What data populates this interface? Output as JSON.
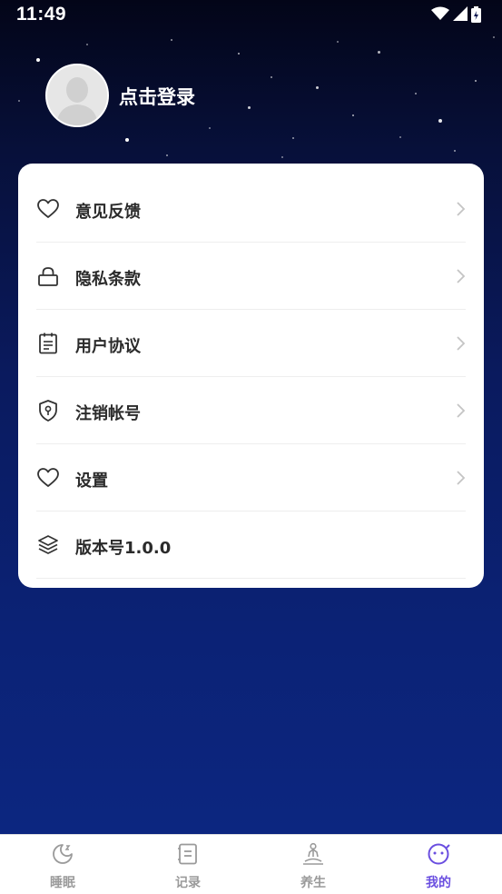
{
  "status_bar": {
    "time": "11:49"
  },
  "profile": {
    "login_label": "点击登录"
  },
  "menu": {
    "items": [
      {
        "label": "意见反馈",
        "icon": "heart-icon",
        "has_arrow": true
      },
      {
        "label": "隐私条款",
        "icon": "lock-icon",
        "has_arrow": true
      },
      {
        "label": "用户协议",
        "icon": "clipboard-icon",
        "has_arrow": true
      },
      {
        "label": "注销帐号",
        "icon": "shield-icon",
        "has_arrow": true
      },
      {
        "label": "设置",
        "icon": "heart-icon",
        "has_arrow": true
      },
      {
        "label": "版本号1.0.0",
        "icon": "layers-icon",
        "has_arrow": false
      }
    ]
  },
  "tabbar": {
    "tabs": [
      {
        "label": "睡眠",
        "icon": "moon-icon",
        "active": false
      },
      {
        "label": "记录",
        "icon": "notebook-icon",
        "active": false
      },
      {
        "label": "养生",
        "icon": "meditation-icon",
        "active": false
      },
      {
        "label": "我的",
        "icon": "smiley-icon",
        "active": true
      }
    ]
  },
  "colors": {
    "accent": "#6a4ee0",
    "inactive_tab": "#9a9a9a",
    "background_top": "#030518",
    "background_bottom": "#0c2680"
  }
}
